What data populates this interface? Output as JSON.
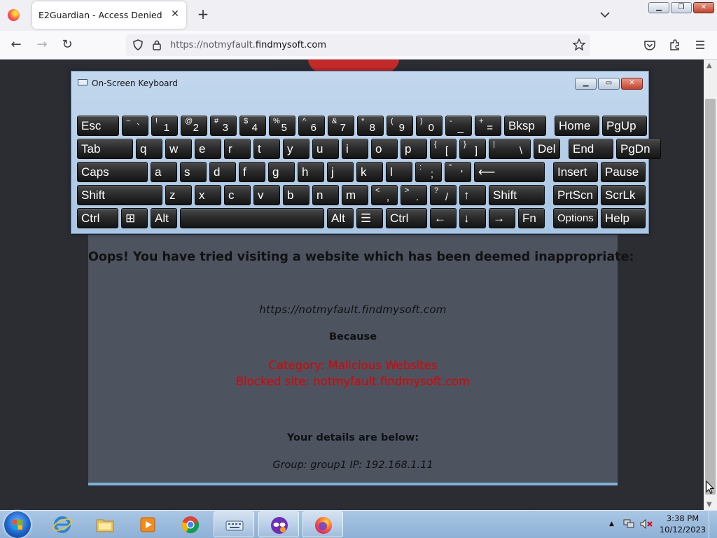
{
  "browser": {
    "tab_title": "E2Guardian - Access Denied",
    "url_scheme": "https://",
    "url_subdomain": "notmyfault.",
    "url_host": "findmysoft.com"
  },
  "osk": {
    "title": "On-Screen Keyboard",
    "rows": [
      [
        {
          "main": "Esc",
          "w": 60
        },
        {
          "shift": "~",
          "lower": "`",
          "w": 38
        },
        {
          "shift": "!",
          "lower": "1",
          "w": 38
        },
        {
          "shift": "@",
          "lower": "2",
          "w": 38
        },
        {
          "shift": "#",
          "lower": "3",
          "w": 38
        },
        {
          "shift": "$",
          "lower": "4",
          "w": 38
        },
        {
          "shift": "%",
          "lower": "5",
          "w": 38
        },
        {
          "shift": "^",
          "lower": "6",
          "w": 38
        },
        {
          "shift": "&",
          "lower": "7",
          "w": 38
        },
        {
          "shift": "*",
          "lower": "8",
          "w": 38
        },
        {
          "shift": "(",
          "lower": "9",
          "w": 38
        },
        {
          "shift": ")",
          "lower": "0",
          "w": 38
        },
        {
          "shift": "-",
          "lower": "_",
          "w": 38
        },
        {
          "shift": "+",
          "lower": "=",
          "w": 38
        },
        {
          "main": "Bksp",
          "w": 60
        },
        {
          "main": "Home",
          "w": 64,
          "gap": 8
        },
        {
          "main": "PgUp",
          "w": 64
        }
      ],
      [
        {
          "main": "Tab",
          "w": 80
        },
        {
          "main": "q",
          "w": 38
        },
        {
          "main": "w",
          "w": 38
        },
        {
          "main": "e",
          "w": 38
        },
        {
          "main": "r",
          "w": 38
        },
        {
          "main": "t",
          "w": 38
        },
        {
          "main": "y",
          "w": 38
        },
        {
          "main": "u",
          "w": 38
        },
        {
          "main": "i",
          "w": 38
        },
        {
          "main": "o",
          "w": 38
        },
        {
          "main": "p",
          "w": 38
        },
        {
          "shift": "{",
          "lower": "[",
          "w": 38
        },
        {
          "shift": "}",
          "lower": "]",
          "w": 38
        },
        {
          "shift": "|",
          "lower": "\\",
          "w": 60
        },
        {
          "main": "Del",
          "w": 38
        },
        {
          "main": "End",
          "w": 64,
          "gap": 8
        },
        {
          "main": "PgDn",
          "w": 64
        }
      ],
      [
        {
          "main": "Caps",
          "w": 101
        },
        {
          "main": "a",
          "w": 38
        },
        {
          "main": "s",
          "w": 38
        },
        {
          "main": "d",
          "w": 38
        },
        {
          "main": "f",
          "w": 38
        },
        {
          "main": "g",
          "w": 38
        },
        {
          "main": "h",
          "w": 38
        },
        {
          "main": "j",
          "w": 38
        },
        {
          "main": "k",
          "w": 38
        },
        {
          "main": "l",
          "w": 38
        },
        {
          "shift": ":",
          "lower": ";",
          "w": 38
        },
        {
          "shift": "\"",
          "lower": "'",
          "w": 38
        },
        {
          "main": "⟵",
          "w": 101
        },
        {
          "main": "Insert",
          "w": 64,
          "gap": 8
        },
        {
          "main": "Pause",
          "w": 64
        }
      ],
      [
        {
          "main": "Shift",
          "w": 122
        },
        {
          "main": "z",
          "w": 38
        },
        {
          "main": "x",
          "w": 38
        },
        {
          "main": "c",
          "w": 38
        },
        {
          "main": "v",
          "w": 38
        },
        {
          "main": "b",
          "w": 38
        },
        {
          "main": "n",
          "w": 38
        },
        {
          "main": "m",
          "w": 38
        },
        {
          "shift": "<",
          "lower": ",",
          "w": 38
        },
        {
          "shift": ">",
          "lower": ".",
          "w": 38
        },
        {
          "shift": "?",
          "lower": "/",
          "w": 38
        },
        {
          "main": "↑",
          "w": 38
        },
        {
          "main": "Shift",
          "w": 80
        },
        {
          "main": "PrtScn",
          "w": 64,
          "gap": 8
        },
        {
          "main": "ScrLk",
          "w": 64
        }
      ],
      [
        {
          "main": "Ctrl",
          "w": 59
        },
        {
          "main": "⊞",
          "w": 38
        },
        {
          "main": "Alt",
          "w": 38
        },
        {
          "main": "",
          "w": 206
        },
        {
          "main": "Alt",
          "w": 38
        },
        {
          "main": "☰",
          "w": 38
        },
        {
          "main": "Ctrl",
          "w": 59
        },
        {
          "main": "←",
          "w": 38
        },
        {
          "main": "↓",
          "w": 38
        },
        {
          "main": "→",
          "w": 38
        },
        {
          "main": "Fn",
          "w": 38
        },
        {
          "main": "Options",
          "w": 64,
          "gap": 8,
          "small": true
        },
        {
          "main": "Help",
          "w": 64
        }
      ]
    ]
  },
  "page": {
    "title": "Oops! You have tried visiting a website which has been deemed inappropriate:",
    "blocked_url": "https://notmyfault.findmysoft.com",
    "because_label": "Because",
    "category_line": "Category: Malicious Websites",
    "blocked_site_line": "Blocked site: notmyfault.findmysoft.com",
    "details_title": "Your details are below:",
    "details_line": "Group: group1   IP: 192.168.1.11"
  },
  "taskbar": {
    "apps": [
      "internet-explorer",
      "file-explorer",
      "media-player",
      "chrome",
      "on-screen-keyboard",
      "unknown-app",
      "firefox"
    ],
    "time": "3:38 PM",
    "date": "10/12/2023"
  }
}
